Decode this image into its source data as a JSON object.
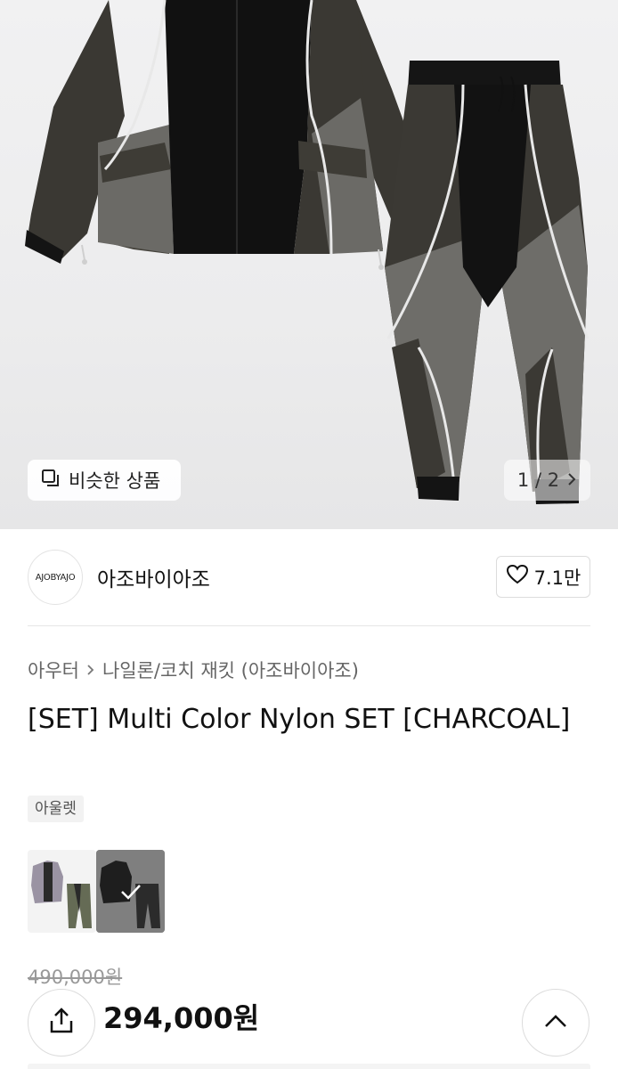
{
  "gallery": {
    "similar_button_label": "비슷한 상품",
    "pager_text": "1 / 2"
  },
  "brand": {
    "logo_text": "AJOBYAJO",
    "name": "아조바이아조",
    "like_count": "7.1만"
  },
  "breadcrumb": {
    "level1": "아우터",
    "level2": "나일론/코치 재킷 (아조바이아조)"
  },
  "product": {
    "title": "[SET] Multi Color Nylon SET [CHARCOAL]",
    "tag": "아울렛",
    "original_price": "490,000원",
    "sale_price": "294,000원"
  },
  "icons": {
    "similar": "copy-squares-icon",
    "pager_next": "chevron-right-icon",
    "like": "heart-outline-icon",
    "share": "share-upload-icon",
    "scroll_top": "chevron-up-icon",
    "selected": "checkmark-icon"
  }
}
